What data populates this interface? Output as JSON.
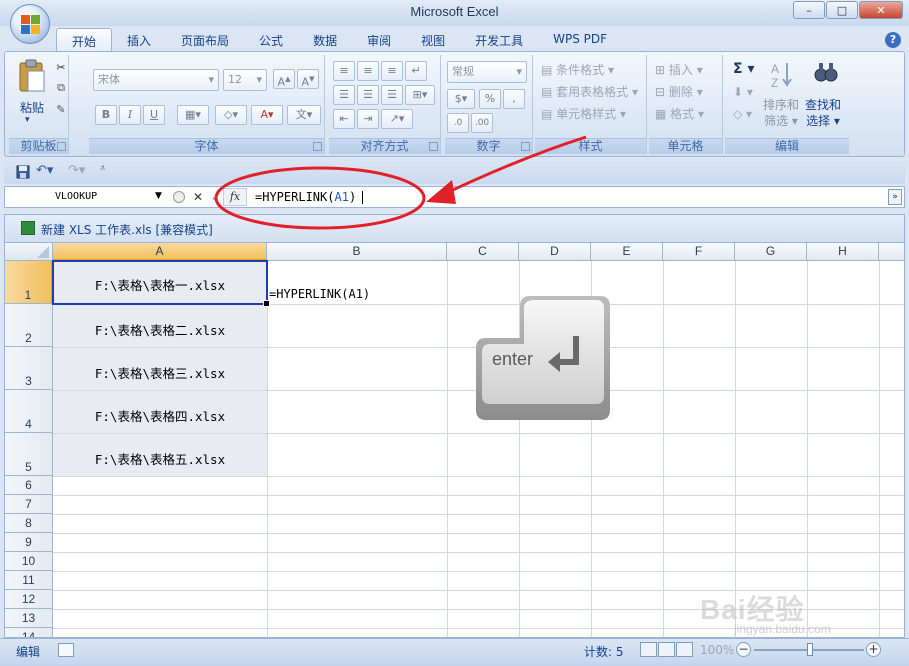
{
  "window": {
    "title": "Microsoft Excel",
    "minimize": "–",
    "maximize": "□",
    "close": "✕"
  },
  "tabs": [
    "开始",
    "插入",
    "页面布局",
    "公式",
    "数据",
    "审阅",
    "视图",
    "开发工具",
    "WPS PDF"
  ],
  "active_tab": "开始",
  "help_label": "?",
  "ribbon": {
    "clipboard": {
      "label": "剪贴板",
      "paste": "粘贴"
    },
    "font": {
      "label": "字体",
      "font_name": "宋体",
      "font_size": "12",
      "bold": "B",
      "italic": "I",
      "underline": "U",
      "phonetic": "文"
    },
    "alignment": {
      "label": "对齐方式"
    },
    "number": {
      "label": "数字",
      "format": "常规",
      "percent": "%",
      "comma": ",",
      "inc": ".0",
      "dec": ".00"
    },
    "styles": {
      "label": "样式",
      "conditional": "条件格式",
      "table": "套用表格格式",
      "cell": "单元格样式"
    },
    "cells": {
      "label": "单元格",
      "insert": "插入",
      "delete": "删除",
      "format": "格式"
    },
    "editing": {
      "label": "编辑",
      "sort": "排序和",
      "sort2": "筛选",
      "find": "查找和",
      "find2": "选择",
      "sigma": "Σ"
    }
  },
  "formula_bar": {
    "name_box": "VLOOKUP",
    "cancel": "✕",
    "confirm": "✓",
    "fx": "fx",
    "formula_prefix": "=HYPERLINK(",
    "formula_ref": "A1",
    "formula_suffix": ")",
    "expand": "»"
  },
  "workbook": {
    "title": "新建 XLS 工作表.xls  [兼容模式]"
  },
  "grid": {
    "columns": [
      "A",
      "B",
      "C",
      "D",
      "E",
      "F",
      "G",
      "H"
    ],
    "rows": [
      "1",
      "2",
      "3",
      "4",
      "5",
      "6",
      "7",
      "8",
      "9",
      "10",
      "11",
      "12",
      "13",
      "14"
    ],
    "cells_A": [
      "F:\\表格\\表格一.xlsx",
      "F:\\表格\\表格二.xlsx",
      "F:\\表格\\表格三.xlsx",
      "F:\\表格\\表格四.xlsx",
      "F:\\表格\\表格五.xlsx"
    ],
    "cell_B1": "=HYPERLINK(A1)"
  },
  "enter_key": {
    "label": "enter"
  },
  "status": {
    "mode": "编辑",
    "count": "计数: 5",
    "zoom": "100%",
    "zoom_minus": "−",
    "zoom_plus": "+"
  },
  "watermark": {
    "brand": "Bai经验",
    "url": "jingyan.baidu.com"
  },
  "colors": {
    "annotation": "#e2202a",
    "selected_header": "#f1c05c",
    "reference_blue": "#2050d0"
  }
}
